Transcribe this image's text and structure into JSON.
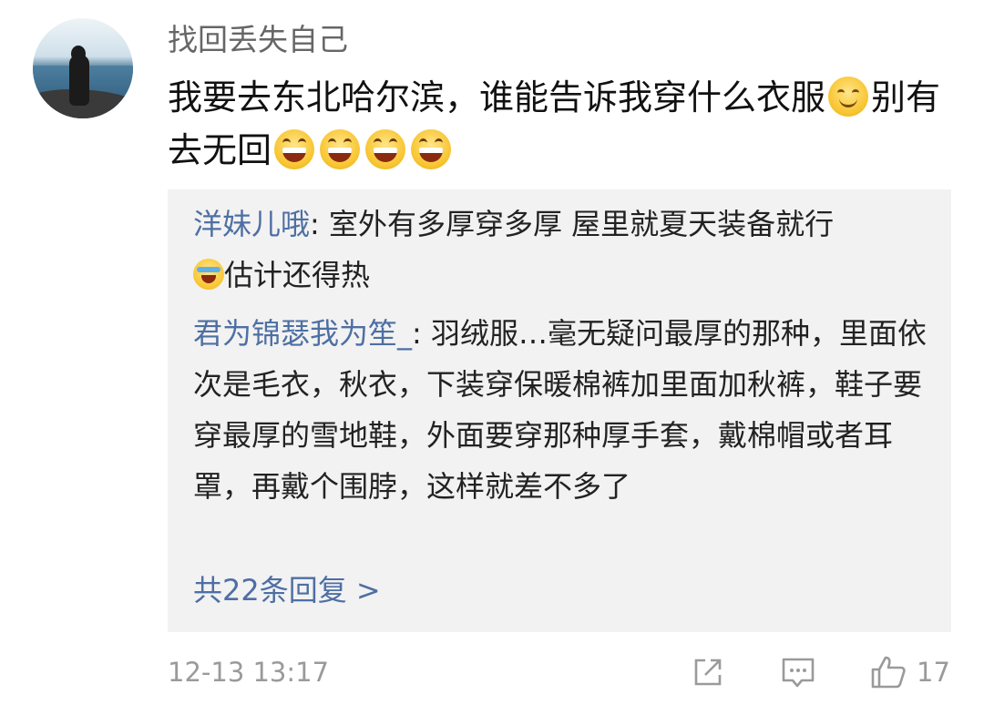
{
  "post": {
    "username": "找回丢失自己",
    "text_part1": "我要去东北哈尔滨，谁能告诉我穿什么衣服",
    "text_part2": "别有去无回",
    "emoji_after_part1": "smile-emoji",
    "emoji_after_part2": [
      "grin-emoji",
      "grin-emoji",
      "grin-emoji",
      "grin-emoji"
    ]
  },
  "replies": [
    {
      "name": "洋妹儿哦",
      "separator": ": ",
      "text_part1": "室外有多厚穿多厚 屋里就夏天装备就行",
      "emoji": "laugh-cry-emoji",
      "text_part2": "估计还得热"
    },
    {
      "name": "君为锦瑟我为笙_",
      "separator": ": ",
      "text": "羽绒服…毫无疑问最厚的那种，里面依次是毛衣，秋衣，下装穿保暖棉裤加里面加秋裤，鞋子要穿最厚的雪地鞋，外面要穿那种厚手套，戴棉帽或者耳罩，再戴个围脖，这样就差不多了"
    }
  ],
  "more_replies_label": "共22条回复 >",
  "footer": {
    "timestamp": "12-13 13:17",
    "share_icon": "share-icon",
    "comment_icon": "comment-icon",
    "like_icon": "thumbs-up-icon",
    "like_count": "17"
  },
  "colors": {
    "link_blue": "#4e6fa3",
    "reply_bg": "#f2f2f2",
    "meta_gray": "#9a9a9a"
  }
}
